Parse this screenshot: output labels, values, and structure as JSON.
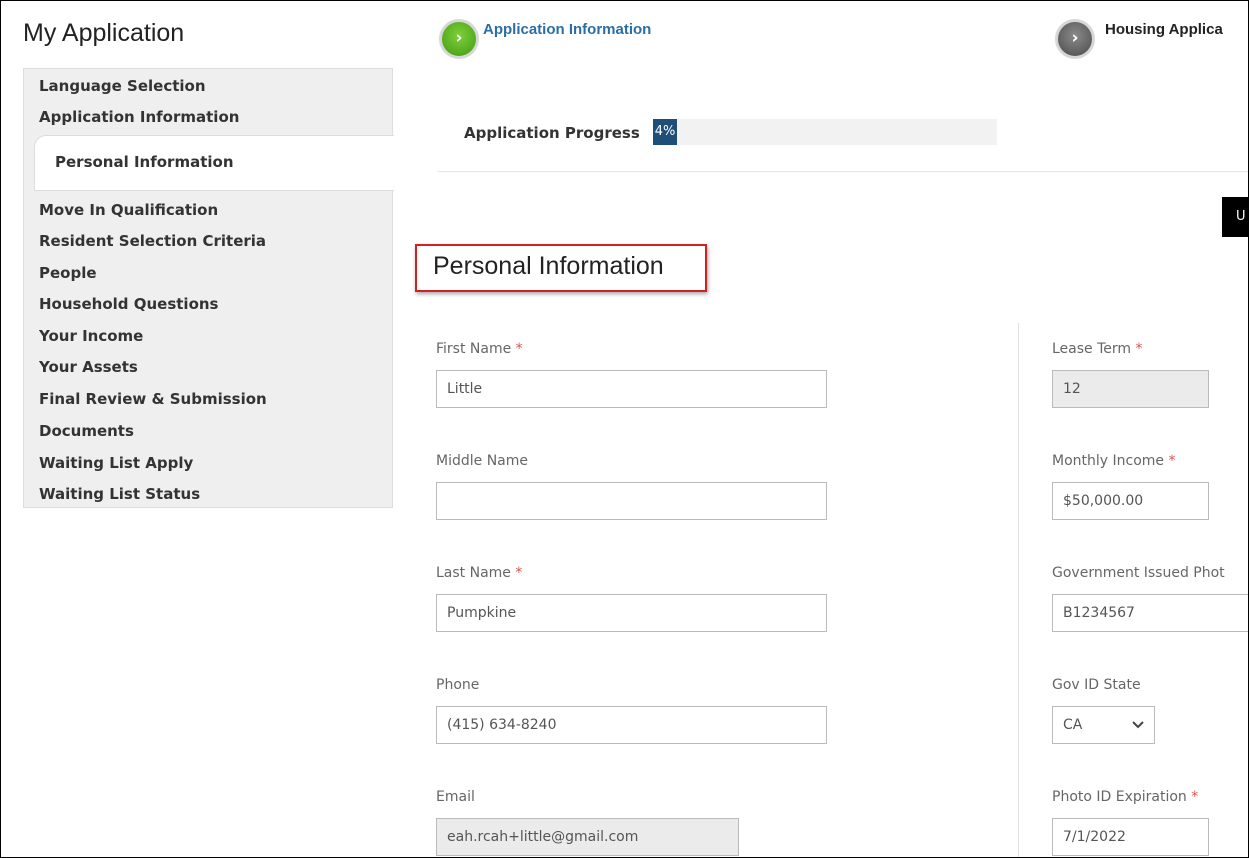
{
  "app": {
    "title": "My Application"
  },
  "sidebar": {
    "items": [
      {
        "label": "Language Selection"
      },
      {
        "label": "Application Information"
      },
      {
        "label": "Personal Information"
      },
      {
        "label": "Move In Qualification"
      },
      {
        "label": "Resident Selection Criteria"
      },
      {
        "label": "People"
      },
      {
        "label": "Household Questions"
      },
      {
        "label": "Your Income"
      },
      {
        "label": "Your Assets"
      },
      {
        "label": "Final Review & Submission"
      },
      {
        "label": "Documents"
      },
      {
        "label": "Waiting List Apply"
      },
      {
        "label": "Waiting List Status"
      }
    ],
    "active_index": 2
  },
  "steps": [
    {
      "label": "Application Information",
      "icon": "chevron-right-icon",
      "color": "#4caf1f"
    },
    {
      "label": "Housing Applica",
      "icon": "chevron-right-icon",
      "color": "#555555"
    }
  ],
  "progress": {
    "label": "Application Progress",
    "text": "4%",
    "value": 0.04,
    "color": "#1f4e79"
  },
  "topbar": {
    "button_text": "U"
  },
  "section": {
    "title": "Personal Information",
    "highlight_color": "#d32020"
  },
  "left_fields": {
    "first_name": {
      "label": "First Name",
      "required_mark": "*",
      "value": "Little"
    },
    "middle_name": {
      "label": "Middle Name",
      "value": ""
    },
    "last_name": {
      "label": "Last Name",
      "required_mark": "*",
      "value": "Pumpkine"
    },
    "phone": {
      "label": "Phone",
      "value": "(415) 634-8240"
    },
    "email": {
      "label": "Email",
      "value": "eah.rcah+little@gmail.com"
    }
  },
  "right_fields": {
    "lease_term": {
      "label": "Lease Term",
      "required_mark": "*",
      "value": "12"
    },
    "monthly_income": {
      "label": "Monthly Income",
      "required_mark": "*",
      "value": "$50,000.00"
    },
    "gov_photo_id": {
      "label": "Government Issued Phot",
      "value": "B1234567"
    },
    "gov_id_state": {
      "label": "Gov ID State",
      "value": "CA"
    },
    "photo_id_expiration": {
      "label": "Photo ID Expiration",
      "required_mark": "*",
      "value": "7/1/2022"
    }
  }
}
